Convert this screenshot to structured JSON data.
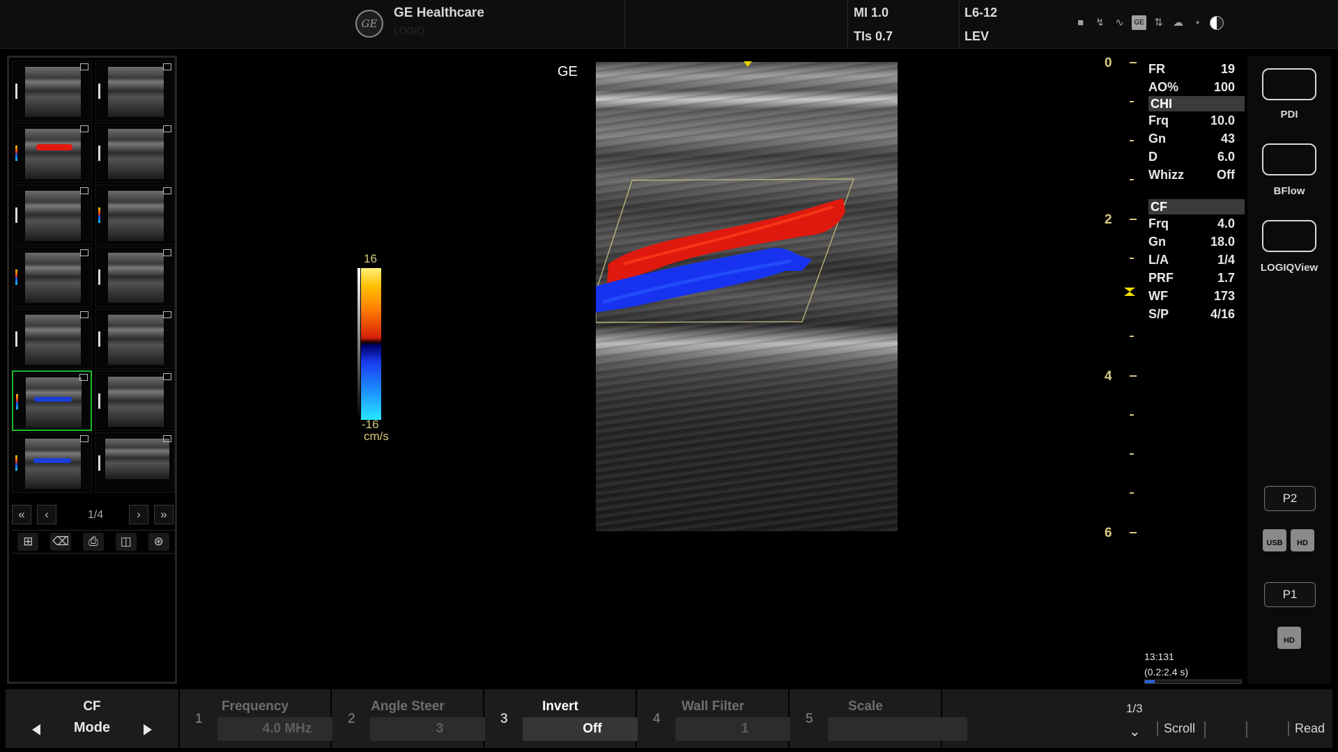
{
  "header": {
    "brand": "GE Healthcare",
    "brand_sub": "LOGIQ",
    "logo_text": "GE",
    "mi": "MI 1.0",
    "tis": "TIs 0.7",
    "probe": "L6-12",
    "preset": "LEV",
    "status_icons": [
      "lock-icon",
      "usb-disconnected-icon",
      "wifi-icon",
      "ge-network-icon",
      "usb-icon",
      "cloud-icon",
      "plug-icon",
      "contrast-icon"
    ]
  },
  "left_panel": {
    "page": "1/4",
    "thumbnails": [
      {
        "type": "gray"
      },
      {
        "type": "gray"
      },
      {
        "type": "red"
      },
      {
        "type": "gray"
      },
      {
        "type": "gray"
      },
      {
        "type": "color"
      },
      {
        "type": "color"
      },
      {
        "type": "gray"
      },
      {
        "type": "gray"
      },
      {
        "type": "gray"
      },
      {
        "type": "blue-selected"
      },
      {
        "type": "gray"
      },
      {
        "type": "blue"
      },
      {
        "type": "gray"
      }
    ],
    "toolbar_icons": [
      "grid-view-icon",
      "trash-icon",
      "print-icon",
      "cine-icon",
      "compare-icon"
    ]
  },
  "image": {
    "ge_label": "GE",
    "colorbar_max": "16",
    "colorbar_min": "-16",
    "colorbar_unit": "cm/s"
  },
  "depth_scale": {
    "labels": [
      "0",
      "2",
      "4",
      "6"
    ]
  },
  "params": {
    "general": [
      {
        "name": "FR",
        "value": "19"
      },
      {
        "name": "AO%",
        "value": "100"
      }
    ],
    "chi_header": "CHI",
    "chi": [
      {
        "name": "Frq",
        "value": "10.0"
      },
      {
        "name": "Gn",
        "value": "43"
      },
      {
        "name": "D",
        "value": "6.0"
      },
      {
        "name": "Whizz",
        "value": "Off"
      }
    ],
    "cf_header": "CF",
    "cf": [
      {
        "name": "Frq",
        "value": "4.0"
      },
      {
        "name": "Gn",
        "value": "18.0"
      },
      {
        "name": "L/A",
        "value": "1/4"
      },
      {
        "name": "PRF",
        "value": "1.7"
      },
      {
        "name": "WF",
        "value": "173"
      },
      {
        "name": "S/P",
        "value": "4/16"
      }
    ]
  },
  "clip": {
    "frame": "13:131",
    "time": "(0.2:2.4 s)",
    "progress": 0.1
  },
  "right_col": {
    "modes": [
      "PDI",
      "BFlow",
      "LOGIQView"
    ],
    "p2": "P2",
    "p1": "P1",
    "usb": "USB",
    "hd": "HD"
  },
  "bottom_bar": {
    "mode_title": "CF",
    "mode_value": "Mode",
    "controls": [
      {
        "num": "1",
        "title": "Frequency",
        "value": "4.0 MHz",
        "active": false
      },
      {
        "num": "2",
        "title": "Angle Steer",
        "value": "3",
        "active": false
      },
      {
        "num": "3",
        "title": "Invert",
        "value": "Off",
        "active": true
      },
      {
        "num": "4",
        "title": "Wall Filter",
        "value": "1",
        "active": false
      },
      {
        "num": "5",
        "title": "Scale",
        "value": "",
        "active": false
      }
    ],
    "page": "1/3",
    "scroll": "Scroll",
    "read": "Read"
  }
}
